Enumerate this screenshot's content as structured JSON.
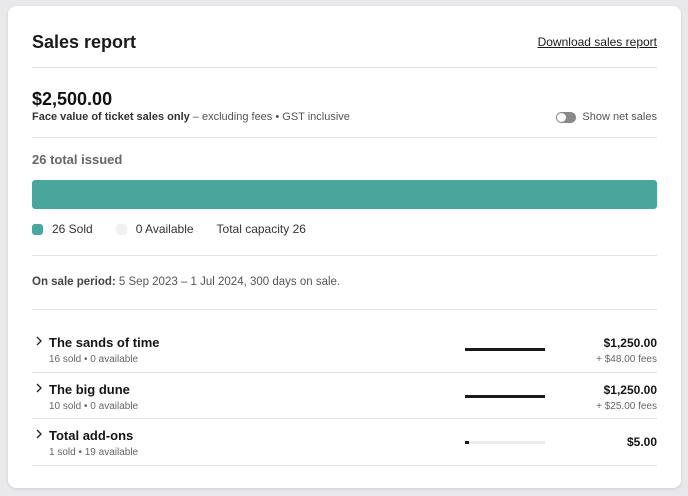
{
  "header": {
    "title": "Sales report",
    "download_label": "Download sales report"
  },
  "summary": {
    "amount": "$2,500.00",
    "face_value_label": "Face value of ticket sales only",
    "face_value_note": " – excluding fees • GST inclusive",
    "toggle_label": "Show net sales",
    "toggle_on": false
  },
  "issued": {
    "label": "26 total issued",
    "sold_fraction": 1.0
  },
  "legend": {
    "sold_label": "26 Sold",
    "available_label": "0 Available",
    "capacity_label": "Total capacity 26"
  },
  "period": {
    "label": "On sale period:",
    "value": " 5 Sep 2023 – 1 Jul 2024, 300 days on sale."
  },
  "rows": [
    {
      "name": "The sands of time",
      "sub": "16 sold • 0 available",
      "price": "$1,250.00",
      "fees": "+ $48.00 fees",
      "progress": 1.0
    },
    {
      "name": "The big dune",
      "sub": "10 sold • 0 available",
      "price": "$1,250.00",
      "fees": "+ $25.00 fees",
      "progress": 1.0
    },
    {
      "name": "Total add-ons",
      "sub": "1 sold • 19 available",
      "price": "$5.00",
      "fees": "",
      "progress": 0.05
    }
  ],
  "colors": {
    "sold": "#4aa69c",
    "available": "#f1f1f1",
    "row_progress": "#1a1a1a"
  }
}
